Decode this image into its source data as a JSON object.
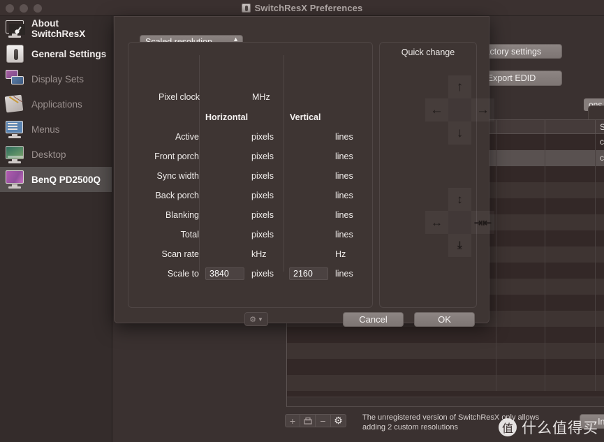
{
  "window": {
    "title": "SwitchResX Preferences",
    "title_icon": "app-icon",
    "traffic_lights": [
      "close",
      "minimize",
      "zoom"
    ]
  },
  "sidebar": {
    "items": [
      {
        "label": "About SwitchResX",
        "icon": "gauge-monitor-icon",
        "state": "enabled"
      },
      {
        "label": "General Settings",
        "icon": "toggle-switch-icon",
        "state": "enabled"
      },
      {
        "label": "Display Sets",
        "icon": "two-displays-icon",
        "state": "disabled"
      },
      {
        "label": "Applications",
        "icon": "documents-icon",
        "state": "disabled"
      },
      {
        "label": "Menus",
        "icon": "menu-window-icon",
        "state": "disabled"
      },
      {
        "label": "Desktop",
        "icon": "desktop-wallpaper-icon",
        "state": "disabled"
      },
      {
        "label": "BenQ PD2500Q",
        "icon": "monitor-icon",
        "state": "selected"
      }
    ]
  },
  "background_panel": {
    "restore_button": "store factory settings",
    "export_edid_button": "Export EDID",
    "group_label": "ons",
    "table": {
      "columns": [
        "",
        "",
        "",
        "Status",
        ""
      ],
      "rows": [
        {
          "status": "ctive",
          "selected": false
        },
        {
          "status": "ctive",
          "selected": true
        },
        {
          "status": "",
          "selected": false
        },
        {
          "status": "",
          "selected": false
        },
        {
          "status": "",
          "selected": false
        },
        {
          "status": "",
          "selected": false
        },
        {
          "status": "",
          "selected": false
        },
        {
          "status": "",
          "selected": false
        },
        {
          "status": "",
          "selected": false
        },
        {
          "status": "",
          "selected": false
        },
        {
          "status": "",
          "selected": false
        },
        {
          "status": "",
          "selected": false
        },
        {
          "status": "",
          "selected": false
        },
        {
          "status": "",
          "selected": false
        },
        {
          "status": "",
          "selected": false
        },
        {
          "status": "",
          "selected": false
        }
      ]
    },
    "segmented_buttons": [
      {
        "icon": "plus-icon",
        "label": "+"
      },
      {
        "icon": "duplicate-icon",
        "label": ""
      },
      {
        "icon": "minus-icon",
        "label": "−"
      },
      {
        "icon": "gear-icon",
        "label": "⚙"
      }
    ],
    "note_line1": "The unregistered version of SwitchResX only allows",
    "note_line2": "adding 2 custom resolutions",
    "install_button": "Install immediately"
  },
  "modal": {
    "mode_popup": {
      "value": "Scaled resolution",
      "chevron": "updown-chevron-icon"
    },
    "pixel_clock": {
      "label": "Pixel clock",
      "unit": "MHz",
      "value": ""
    },
    "column_headers": {
      "horizontal": "Horizontal",
      "vertical": "Vertical"
    },
    "rows": [
      {
        "label": "Active",
        "h_value": "",
        "h_unit": "pixels",
        "v_value": "",
        "v_unit": "lines"
      },
      {
        "label": "Front porch",
        "h_value": "",
        "h_unit": "pixels",
        "v_value": "",
        "v_unit": "lines"
      },
      {
        "label": "Sync width",
        "h_value": "",
        "h_unit": "pixels",
        "v_value": "",
        "v_unit": "lines"
      },
      {
        "label": "Back porch",
        "h_value": "",
        "h_unit": "pixels",
        "v_value": "",
        "v_unit": "lines"
      },
      {
        "label": "Blanking",
        "h_value": "",
        "h_unit": "pixels",
        "v_value": "",
        "v_unit": "lines"
      },
      {
        "label": "Total",
        "h_value": "",
        "h_unit": "pixels",
        "v_value": "",
        "v_unit": "lines"
      },
      {
        "label": "Scan rate",
        "h_value": "",
        "h_unit": "kHz",
        "v_value": "",
        "v_unit": "Hz"
      },
      {
        "label": "Scale to",
        "h_value": "3840",
        "h_unit": "pixels",
        "v_value": "2160",
        "v_unit": "lines"
      }
    ],
    "quick_change": {
      "title": "Quick change",
      "move_pad": {
        "up": "arrow-up-icon",
        "left": "arrow-left-icon",
        "right": "arrow-right-icon",
        "down": "arrow-down-icon"
      },
      "size_pad": {
        "up": "expand-vertical-icon",
        "left": "expand-horizontal-icon",
        "right": "shrink-horizontal-icon",
        "down": "shrink-vertical-icon"
      }
    },
    "gear_menu": {
      "icon": "gear-icon",
      "chevron": "chevron-down-icon"
    },
    "cancel_button": "Cancel",
    "ok_button": "OK"
  },
  "watermark": {
    "logo": "值",
    "text": "什么值得买"
  },
  "colors": {
    "window_bg": "#3a3130",
    "sidebar_bg": "#342c2b",
    "selected_row": "#595150",
    "button_face": "#857d7b",
    "text_primary": "#efecea",
    "text_disabled": "#9a908e"
  }
}
